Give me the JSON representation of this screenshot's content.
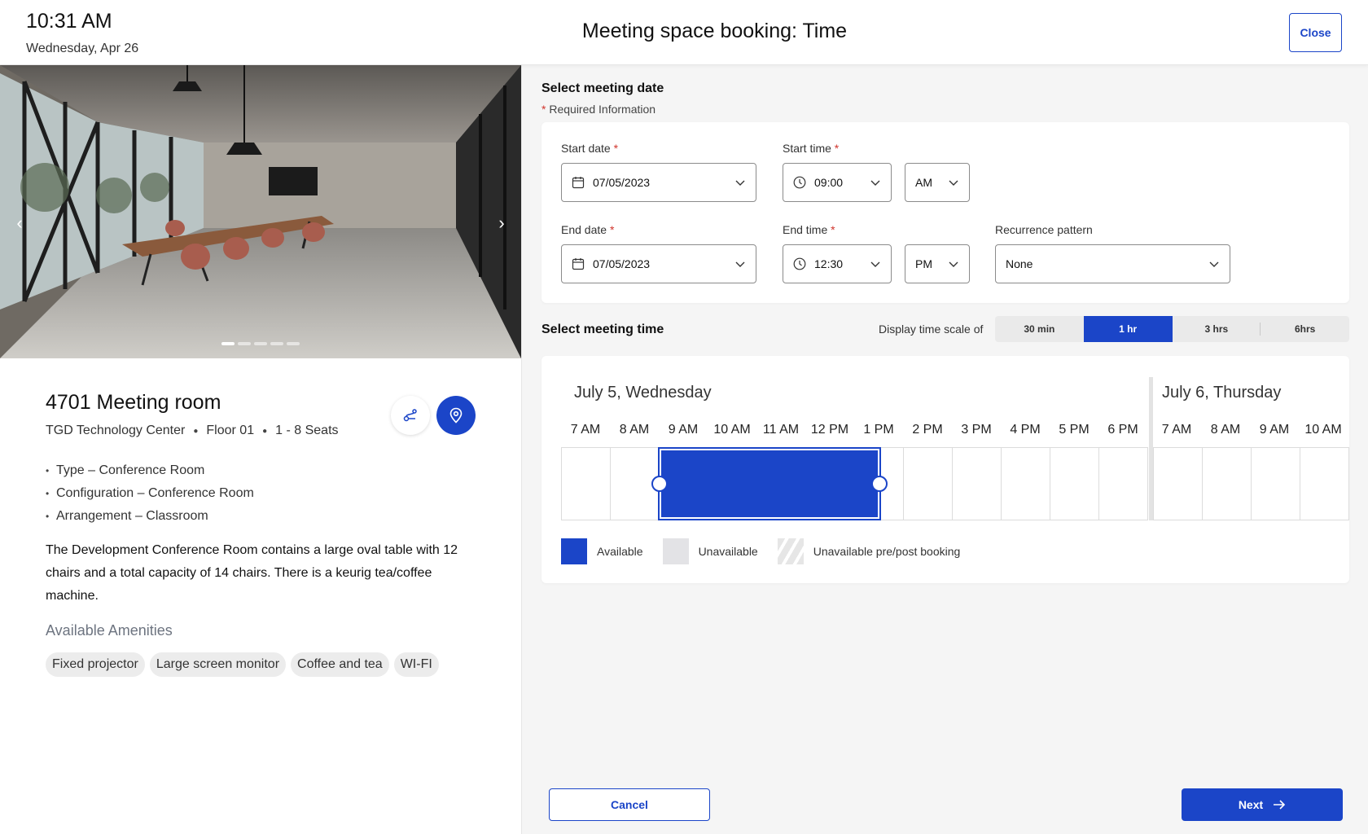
{
  "header": {
    "time": "10:31 AM",
    "date": "Wednesday, Apr 26",
    "title": "Meeting space booking: Time",
    "close_label": "Close"
  },
  "room": {
    "name": "4701 Meeting room",
    "building": "TGD Technology Center",
    "floor": "Floor 01",
    "seats": "1 - 8 Seats",
    "attributes": [
      "Type – Conference Room",
      "Configuration – Conference Room",
      "Arrangement – Classroom"
    ],
    "description": "The Development Conference Room contains a large oval table with 12 chairs and a total capacity of 14 chairs.  There is a keurig tea/coffee machine.",
    "amenities_title": "Available Amenities",
    "amenities": [
      "Fixed projector",
      "Large screen monitor",
      "Coffee and tea",
      "WI-FI"
    ],
    "photo_count": 5,
    "photo_index": 0
  },
  "date_section": {
    "title": "Select meeting date",
    "required_note": "Required Information",
    "start_date_label": "Start date",
    "start_date": "07/05/2023",
    "start_time_label": "Start time",
    "start_time": "09:00",
    "start_ampm": "AM",
    "end_date_label": "End date",
    "end_date": "07/05/2023",
    "end_time_label": "End time",
    "end_time": "12:30",
    "end_ampm": "PM",
    "recurrence_label": "Recurrence pattern",
    "recurrence": "None"
  },
  "time_section": {
    "title": "Select meeting time",
    "scale_label": "Display time scale of",
    "scales": [
      "30 min",
      "1 hr",
      "3 hrs",
      "6hrs"
    ],
    "active_scale": "1 hr",
    "day1": "July 5, Wednesday",
    "day1_hours": [
      "7 AM",
      "8 AM",
      "9 AM",
      "10 AM",
      "11 AM",
      "12 PM",
      "1 PM",
      "2 PM",
      "3 PM",
      "4 PM",
      "5 PM",
      "6 PM"
    ],
    "day2": "July 6, Thursday",
    "day2_hours": [
      "7 AM",
      "8 AM",
      "9 AM",
      "10 AM"
    ],
    "selection_start": "9:00 AM",
    "selection_end": "12:30 PM",
    "legend": [
      "Available",
      "Unavailable",
      "Unavailable pre/post booking"
    ]
  },
  "footer": {
    "cancel_label": "Cancel",
    "next_label": "Next"
  },
  "colors": {
    "accent": "#1b45c8",
    "required": "#d0342c"
  }
}
